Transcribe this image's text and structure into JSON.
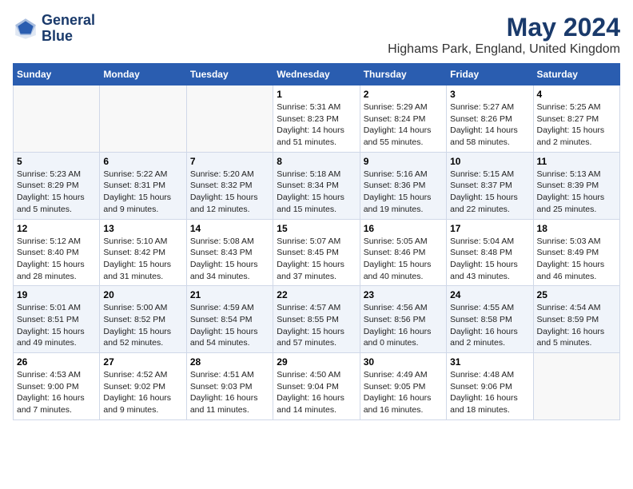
{
  "logo": {
    "line1": "General",
    "line2": "Blue"
  },
  "title": "May 2024",
  "subtitle": "Highams Park, England, United Kingdom",
  "headers": [
    "Sunday",
    "Monday",
    "Tuesday",
    "Wednesday",
    "Thursday",
    "Friday",
    "Saturday"
  ],
  "weeks": [
    [
      {
        "day": "",
        "info": ""
      },
      {
        "day": "",
        "info": ""
      },
      {
        "day": "",
        "info": ""
      },
      {
        "day": "1",
        "info": "Sunrise: 5:31 AM\nSunset: 8:23 PM\nDaylight: 14 hours\nand 51 minutes."
      },
      {
        "day": "2",
        "info": "Sunrise: 5:29 AM\nSunset: 8:24 PM\nDaylight: 14 hours\nand 55 minutes."
      },
      {
        "day": "3",
        "info": "Sunrise: 5:27 AM\nSunset: 8:26 PM\nDaylight: 14 hours\nand 58 minutes."
      },
      {
        "day": "4",
        "info": "Sunrise: 5:25 AM\nSunset: 8:27 PM\nDaylight: 15 hours\nand 2 minutes."
      }
    ],
    [
      {
        "day": "5",
        "info": "Sunrise: 5:23 AM\nSunset: 8:29 PM\nDaylight: 15 hours\nand 5 minutes."
      },
      {
        "day": "6",
        "info": "Sunrise: 5:22 AM\nSunset: 8:31 PM\nDaylight: 15 hours\nand 9 minutes."
      },
      {
        "day": "7",
        "info": "Sunrise: 5:20 AM\nSunset: 8:32 PM\nDaylight: 15 hours\nand 12 minutes."
      },
      {
        "day": "8",
        "info": "Sunrise: 5:18 AM\nSunset: 8:34 PM\nDaylight: 15 hours\nand 15 minutes."
      },
      {
        "day": "9",
        "info": "Sunrise: 5:16 AM\nSunset: 8:36 PM\nDaylight: 15 hours\nand 19 minutes."
      },
      {
        "day": "10",
        "info": "Sunrise: 5:15 AM\nSunset: 8:37 PM\nDaylight: 15 hours\nand 22 minutes."
      },
      {
        "day": "11",
        "info": "Sunrise: 5:13 AM\nSunset: 8:39 PM\nDaylight: 15 hours\nand 25 minutes."
      }
    ],
    [
      {
        "day": "12",
        "info": "Sunrise: 5:12 AM\nSunset: 8:40 PM\nDaylight: 15 hours\nand 28 minutes."
      },
      {
        "day": "13",
        "info": "Sunrise: 5:10 AM\nSunset: 8:42 PM\nDaylight: 15 hours\nand 31 minutes."
      },
      {
        "day": "14",
        "info": "Sunrise: 5:08 AM\nSunset: 8:43 PM\nDaylight: 15 hours\nand 34 minutes."
      },
      {
        "day": "15",
        "info": "Sunrise: 5:07 AM\nSunset: 8:45 PM\nDaylight: 15 hours\nand 37 minutes."
      },
      {
        "day": "16",
        "info": "Sunrise: 5:05 AM\nSunset: 8:46 PM\nDaylight: 15 hours\nand 40 minutes."
      },
      {
        "day": "17",
        "info": "Sunrise: 5:04 AM\nSunset: 8:48 PM\nDaylight: 15 hours\nand 43 minutes."
      },
      {
        "day": "18",
        "info": "Sunrise: 5:03 AM\nSunset: 8:49 PM\nDaylight: 15 hours\nand 46 minutes."
      }
    ],
    [
      {
        "day": "19",
        "info": "Sunrise: 5:01 AM\nSunset: 8:51 PM\nDaylight: 15 hours\nand 49 minutes."
      },
      {
        "day": "20",
        "info": "Sunrise: 5:00 AM\nSunset: 8:52 PM\nDaylight: 15 hours\nand 52 minutes."
      },
      {
        "day": "21",
        "info": "Sunrise: 4:59 AM\nSunset: 8:54 PM\nDaylight: 15 hours\nand 54 minutes."
      },
      {
        "day": "22",
        "info": "Sunrise: 4:57 AM\nSunset: 8:55 PM\nDaylight: 15 hours\nand 57 minutes."
      },
      {
        "day": "23",
        "info": "Sunrise: 4:56 AM\nSunset: 8:56 PM\nDaylight: 16 hours\nand 0 minutes."
      },
      {
        "day": "24",
        "info": "Sunrise: 4:55 AM\nSunset: 8:58 PM\nDaylight: 16 hours\nand 2 minutes."
      },
      {
        "day": "25",
        "info": "Sunrise: 4:54 AM\nSunset: 8:59 PM\nDaylight: 16 hours\nand 5 minutes."
      }
    ],
    [
      {
        "day": "26",
        "info": "Sunrise: 4:53 AM\nSunset: 9:00 PM\nDaylight: 16 hours\nand 7 minutes."
      },
      {
        "day": "27",
        "info": "Sunrise: 4:52 AM\nSunset: 9:02 PM\nDaylight: 16 hours\nand 9 minutes."
      },
      {
        "day": "28",
        "info": "Sunrise: 4:51 AM\nSunset: 9:03 PM\nDaylight: 16 hours\nand 11 minutes."
      },
      {
        "day": "29",
        "info": "Sunrise: 4:50 AM\nSunset: 9:04 PM\nDaylight: 16 hours\nand 14 minutes."
      },
      {
        "day": "30",
        "info": "Sunrise: 4:49 AM\nSunset: 9:05 PM\nDaylight: 16 hours\nand 16 minutes."
      },
      {
        "day": "31",
        "info": "Sunrise: 4:48 AM\nSunset: 9:06 PM\nDaylight: 16 hours\nand 18 minutes."
      },
      {
        "day": "",
        "info": ""
      }
    ]
  ]
}
